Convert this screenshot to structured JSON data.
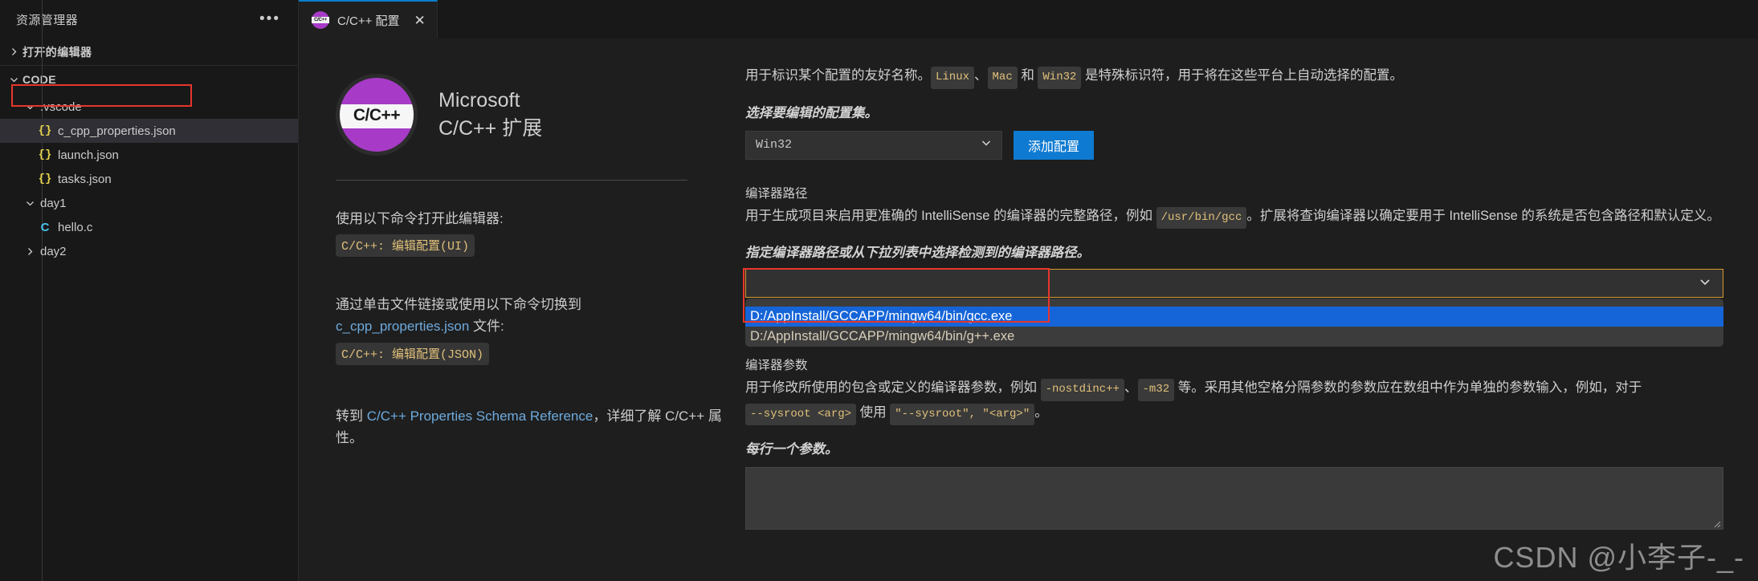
{
  "sidebar": {
    "title": "资源管理器",
    "more_icon": "ellipsis-icon",
    "sections": [
      {
        "label": "打开的编辑器",
        "expanded": false
      },
      {
        "label": "CODE",
        "expanded": true
      }
    ],
    "tree": [
      {
        "label": ".vscode",
        "kind": "folder",
        "expanded": true,
        "depth": 1
      },
      {
        "label": "c_cpp_properties.json",
        "kind": "json",
        "depth": 2,
        "selected": true,
        "highlighted": true
      },
      {
        "label": "launch.json",
        "kind": "json",
        "depth": 2
      },
      {
        "label": "tasks.json",
        "kind": "json",
        "depth": 2
      },
      {
        "label": "day1",
        "kind": "folder",
        "expanded": true,
        "depth": 1
      },
      {
        "label": "hello.c",
        "kind": "c",
        "depth": 2
      },
      {
        "label": "day2",
        "kind": "folder",
        "expanded": false,
        "depth": 1
      }
    ]
  },
  "tabbar": {
    "tab_label": "C/C++ 配置",
    "tab_icon_text": "C/C++",
    "close_label": "✕"
  },
  "left_panel": {
    "logo_text": "C/C++",
    "publisher": "Microsoft",
    "extension_name": "C/C++ 扩展",
    "block1": {
      "text": "使用以下命令打开此编辑器:",
      "code": "C/C++: 编辑配置(UI)"
    },
    "block2": {
      "text_a": "通过单击文件链接或使用以下命令切换到",
      "link": "c_cpp_properties.json",
      "text_b": " 文件:",
      "code": "C/C++: 编辑配置(JSON)"
    },
    "block3": {
      "text_a": "转到 ",
      "link": "C/C++ Properties Schema Reference",
      "text_b": "，详细了解 C/C++ 属性。"
    }
  },
  "right_panel": {
    "name_desc": {
      "part1": "用于标识某个配置的友好名称。",
      "code1": "Linux",
      "sep1": "、",
      "code2": "Mac",
      "sep2": " 和 ",
      "code3": "Win32",
      "part2": " 是特殊标识符，用于将在这些平台上自动选择的配置。"
    },
    "config_set_note": "选择要编辑的配置集。",
    "config_select": {
      "value": "Win32",
      "chevron": "chevron-down-icon"
    },
    "add_config_button": "添加配置",
    "compiler_path": {
      "label": "编译器路径",
      "desc_part1": "用于生成项目来启用更准确的 IntelliSense 的编译器的完整路径，例如 ",
      "desc_code": "/usr/bin/gcc",
      "desc_part2": "。扩展将查询编译器以确定要用于 IntelliSense 的系统是否包含路径和默认定义。",
      "italic_note": "指定编译器路径或从下拉列表中选择检测到的编译器路径。",
      "input_value": "",
      "chevron": "chevron-down-icon",
      "dropdown_options": [
        {
          "label": "D:/AppInstall/GCCAPP/mingw64/bin/gcc.exe",
          "selected": true
        },
        {
          "label": "D:/AppInstall/GCCAPP/mingw64/bin/g++.exe",
          "selected": false
        }
      ]
    },
    "compiler_args": {
      "label": "编译器参数",
      "desc_part1": "用于修改所使用的包含或定义的编译器参数，例如 ",
      "code1": "-nostdinc++",
      "sep1": "、",
      "code2": "-m32",
      "desc_part2": " 等。采用其他空格分隔参数的参数应在数组中作为单独的参数输入，例如，对于 ",
      "code3": "--sysroot <arg>",
      "desc_part3": " 使用 ",
      "code4": "\"--sysroot\", \"<arg>\"",
      "desc_part4": "。",
      "italic_note": "每行一个参数。",
      "textarea_value": ""
    }
  },
  "watermark": "CSDN @小李子-_-",
  "colors": {
    "accent_blue": "#0e7ad1",
    "selection_blue": "#1565d8",
    "annotation_red": "#e8352b",
    "focus_orange": "#d59b2b",
    "logo_purple": "#a73bc7",
    "code_text": "#e0c07a",
    "link_blue": "#6eaadd"
  }
}
